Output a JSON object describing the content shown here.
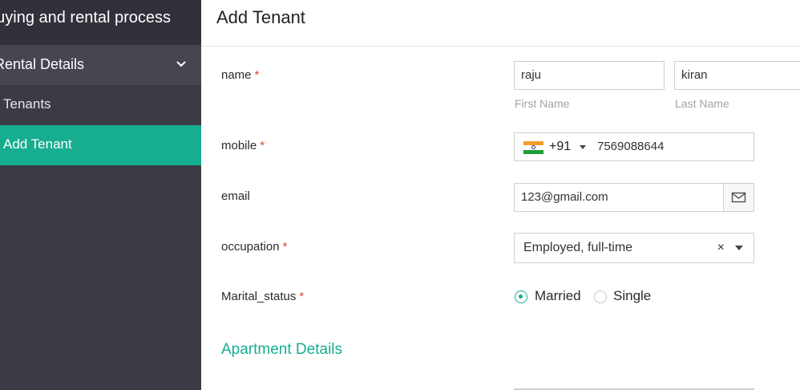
{
  "sidebar": {
    "title": "buying and rental process",
    "section": {
      "label": "Rental Details",
      "chevron_icon": "chevron-down-icon"
    },
    "items": [
      {
        "label": "Tenants",
        "active": false
      },
      {
        "label": "Add Tenant",
        "active": true
      }
    ],
    "colors": {
      "bg": "#3a3b44",
      "active": "#17ad90"
    }
  },
  "main": {
    "title": "Add Tenant",
    "fields": {
      "name": {
        "label": "name",
        "required_mark": "*",
        "first_value": "raju",
        "first_sublabel": "First Name",
        "last_value": "kiran",
        "last_sublabel": "Last Name"
      },
      "mobile": {
        "label": "mobile",
        "required_mark": "*",
        "country_flag_icon": "india-flag-icon",
        "country_code": "+91",
        "number": "7569088644"
      },
      "email": {
        "label": "email",
        "value": "123@gmail.com",
        "icon": "envelope-icon"
      },
      "occupation": {
        "label": "occupation",
        "required_mark": "*",
        "selected": "Employed, full-time",
        "clear_symbol": "×"
      },
      "marital_status": {
        "label": "Marital_status",
        "required_mark": "*",
        "options": [
          {
            "label": "Married",
            "checked": true
          },
          {
            "label": "Single",
            "checked": false
          }
        ]
      }
    },
    "section_title": "Apartment Details"
  }
}
